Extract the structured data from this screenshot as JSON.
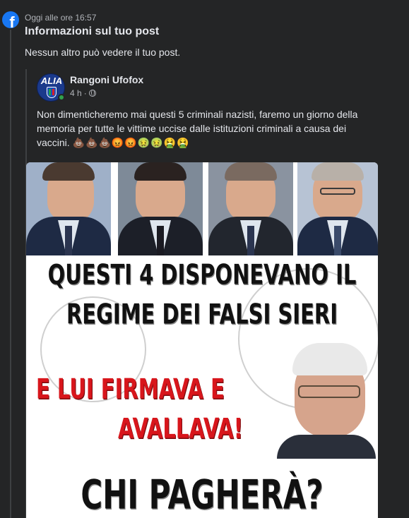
{
  "notification": {
    "timestamp": "Oggi alle ore 16:57",
    "title": "Informazioni sul tuo post",
    "body": "Nessun altro può vedere il tuo post.",
    "app_icon": "facebook-icon",
    "brand_color": "#1877f2"
  },
  "post": {
    "author": "Rangoni Ufofox",
    "avatar_text": "ALIA",
    "time": "4 h",
    "separator": "·",
    "privacy_icon": "globe-icon",
    "text": "Non dimenticheremo mai questi 5 criminali nazisti, faremo un giorno della memoria per tutte le vittime uccise dalle istituzioni criminali a causa dei vaccini.",
    "emojis": "💩💩💩😡😡🤢🤢🤮🤮",
    "online_color": "#31a24c"
  },
  "image": {
    "line1": "QUESTI 4 DISPONEVANO IL",
    "line2": "REGIME DEI FALSI SIERI",
    "line3": "E LUI FIRMAVA E",
    "line4": "AVALLAVA!",
    "line5": "CHI PAGHERÀ?",
    "red_color": "#d8161c"
  }
}
